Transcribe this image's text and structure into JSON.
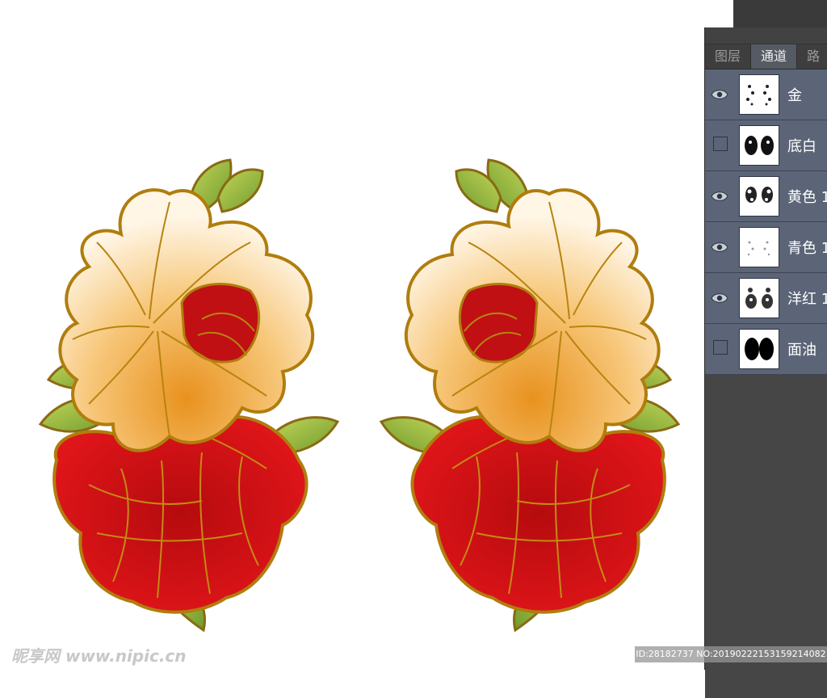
{
  "tabs": [
    {
      "label": "图层",
      "active": false
    },
    {
      "label": "通道",
      "active": true
    },
    {
      "label": "路",
      "active": false
    }
  ],
  "channels": [
    {
      "name": "金",
      "visible": true
    },
    {
      "name": "底白",
      "visible": false
    },
    {
      "name": "黄色 1",
      "visible": true
    },
    {
      "name": "青色 1",
      "visible": true
    },
    {
      "name": "洋红 1",
      "visible": true
    },
    {
      "name": "面油",
      "visible": false
    }
  ],
  "watermark": {
    "brand": "昵享网 www.nipic.cn",
    "id_text": "ID:28182737 NO:20190222153159214082"
  },
  "colors": {
    "panel_bg": "#4b4b4b",
    "channel_row": "#5b6577",
    "petal_red": "#d50f12",
    "petal_cream": "#fbe3b6",
    "outline_gold": "#a8740c",
    "leaf_green": "#8fb53a"
  }
}
